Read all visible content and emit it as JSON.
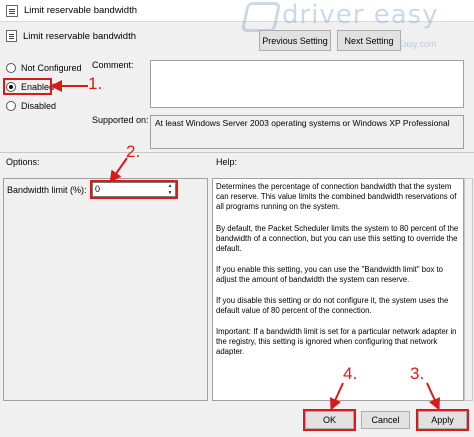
{
  "window": {
    "title": "Limit reservable bandwidth"
  },
  "watermark": {
    "brand": "driver easy",
    "site": "www.DriverEasy.com"
  },
  "header": {
    "title": "Limit reservable bandwidth",
    "prev_label": "Previous Setting",
    "next_label": "Next Setting"
  },
  "state": {
    "options": [
      {
        "label": "Not Configured",
        "selected": false
      },
      {
        "label": "Enabled",
        "selected": true
      },
      {
        "label": "Disabled",
        "selected": false
      }
    ]
  },
  "comment": {
    "label": "Comment:",
    "value": ""
  },
  "supported": {
    "label": "Supported on:",
    "value": "At least Windows Server 2003 operating systems or Windows XP Professional"
  },
  "options_panel": {
    "label": "Options:",
    "bandwidth_label": "Bandwidth limit (%):",
    "bandwidth_value": "0"
  },
  "help": {
    "label": "Help:",
    "paragraphs": [
      "Determines the percentage of connection bandwidth that the system can reserve. This value limits the combined bandwidth reservations of all programs running on the system.",
      "By default, the Packet Scheduler limits the system to 80 percent of the bandwidth of a connection, but you can use this setting to override the default.",
      "If you enable this setting, you can use the \"Bandwidth limit\" box to adjust the amount of bandwidth the system can reserve.",
      "If you disable this setting or do not configure it, the system uses the default value of 80 percent of the connection.",
      "Important: If a bandwidth limit is set for a particular network adapter in the registry, this setting is ignored when configuring that network adapter."
    ]
  },
  "footer": {
    "ok_label": "OK",
    "cancel_label": "Cancel",
    "apply_label": "Apply"
  },
  "annotations": {
    "step1": "1.",
    "step2": "2.",
    "step3": "3.",
    "step4": "4.",
    "color": "#d81a1a"
  }
}
